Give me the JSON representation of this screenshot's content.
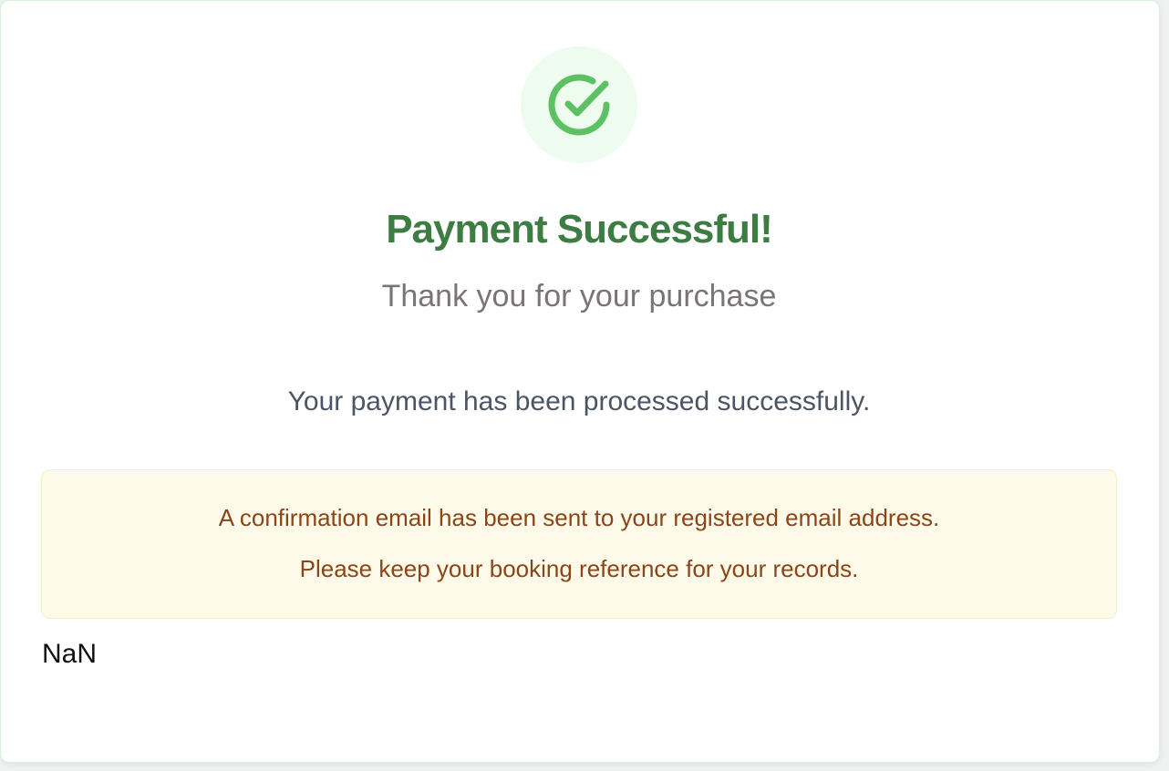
{
  "success_card": {
    "icon": "check-circle-icon",
    "title": "Payment Successful!",
    "subtitle": "Thank you for your purchase",
    "message": "Your payment has been processed successfully.",
    "notice": {
      "line1": "A confirmation email has been sent to your registered email address.",
      "line2": "Please keep your booking reference for your records."
    },
    "booking_reference": "NaN"
  },
  "colors": {
    "title": "#3d7d44",
    "icon_stroke": "#5cc163",
    "icon_background": "#eefbef",
    "notice_background": "#fefae9",
    "notice_text": "#8a4519"
  }
}
